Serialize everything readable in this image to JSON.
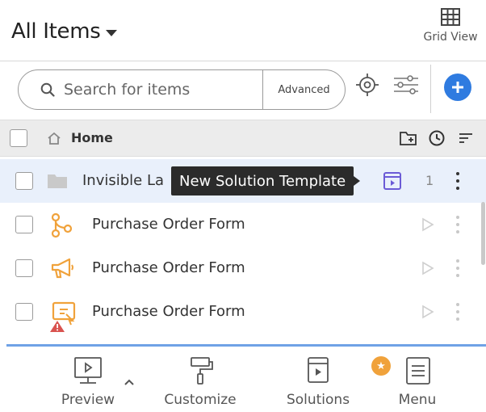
{
  "header": {
    "title": "All Items",
    "grid_view_label": "Grid View"
  },
  "search": {
    "placeholder": "Search for items",
    "value": "",
    "advanced_label": "Advanced"
  },
  "breadcrumb": {
    "home_label": "Home"
  },
  "rows": [
    {
      "name": "Invisible La",
      "icon": "folder-icon",
      "count": "1",
      "selected": true
    },
    {
      "name": "Purchase Order Form",
      "icon": "workflow-icon",
      "selected": false
    },
    {
      "name": "Purchase Order Form",
      "icon": "megaphone-icon",
      "selected": false
    },
    {
      "name": "Purchase Order Form",
      "icon": "form-warning-icon",
      "selected": false
    }
  ],
  "tooltip": {
    "text": "New Solution Template"
  },
  "footer": {
    "preview_label": "Preview",
    "customize_label": "Customize",
    "solutions_label": "Solutions",
    "menu_label": "Menu"
  },
  "colors": {
    "accent": "#2f7be0",
    "selected_row": "#e9f0fb",
    "badge": "#f0a23b",
    "warning": "#d9534f",
    "orange_icon": "#f0a23b"
  }
}
